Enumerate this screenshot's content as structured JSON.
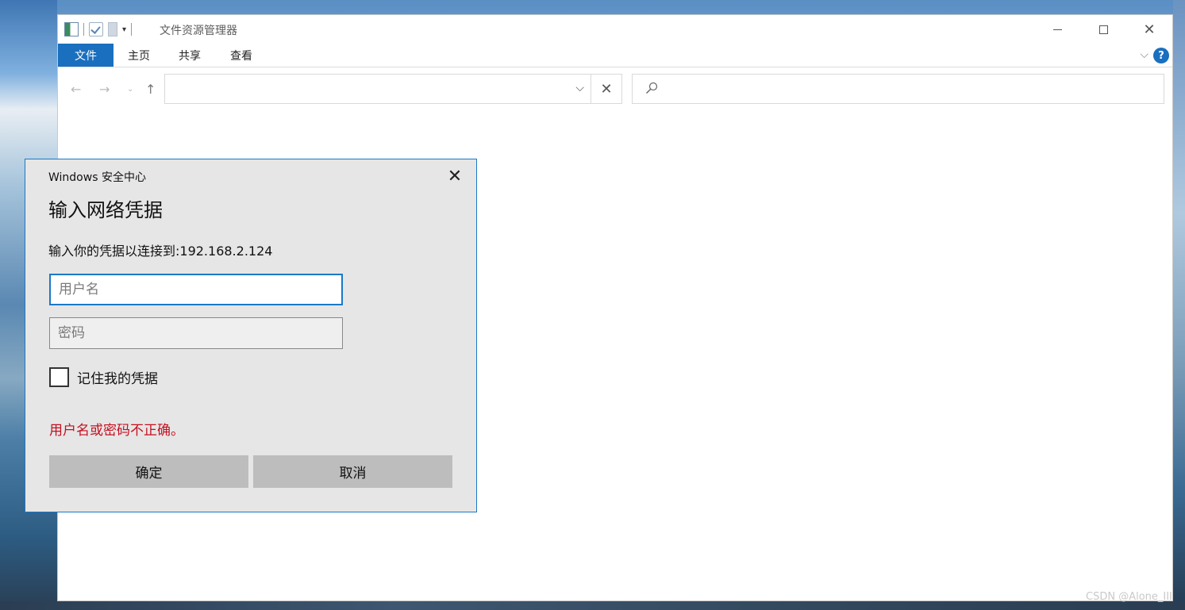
{
  "explorer": {
    "title": "文件资源管理器",
    "ribbon_tabs": [
      "文件",
      "主页",
      "共享",
      "查看"
    ],
    "help_label": "?",
    "address_value": "",
    "search_placeholder": ""
  },
  "dialog": {
    "app_name": "Windows 安全中心",
    "heading": "输入网络凭据",
    "description": "输入你的凭据以连接到:192.168.2.124",
    "username_placeholder": "用户名",
    "username_value": "",
    "password_placeholder": "密码",
    "remember_label": "记住我的凭据",
    "remember_checked": false,
    "error_text": "用户名或密码不正确。",
    "ok_label": "确定",
    "cancel_label": "取消",
    "error_color": "#c50f1f",
    "accent_color": "#1b78c8"
  },
  "watermark": "CSDN @Alone_III"
}
